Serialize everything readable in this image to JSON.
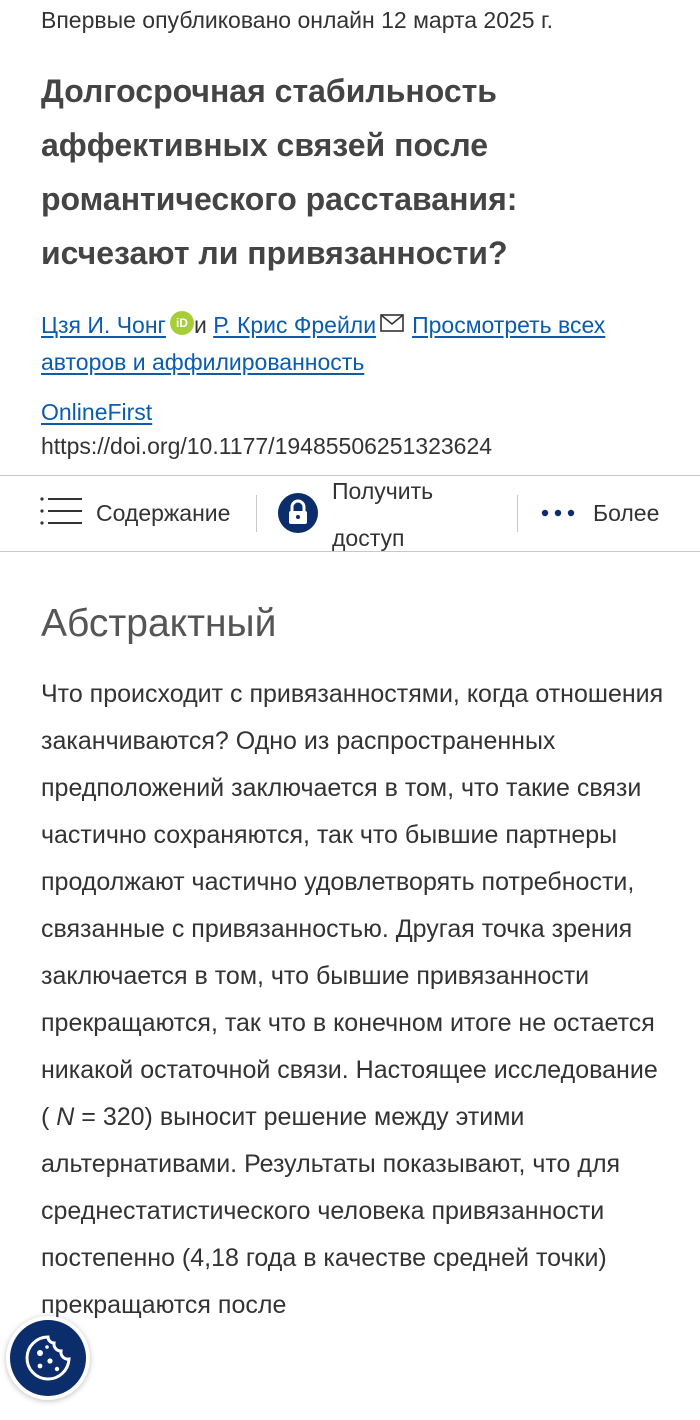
{
  "article": {
    "pub_date": "Впервые опубликовано онлайн 12 марта 2025 г.",
    "title": "Долгосрочная стабильность аффективных связей после романтического расставания: исчезают ли привязанности?",
    "authors": {
      "author1": "Цзя И. Чонг",
      "orcid_label": "iD",
      "conjunction": "и",
      "author2": "Р. Крис Фрейли",
      "view_all": "Просмотреть всех авторов и аффилированность"
    },
    "online_first": "OnlineFirst",
    "doi": "https://doi.org/10.1177/19485506251323624"
  },
  "toolbar": {
    "contents_label": "Содержание",
    "access_label": "Получить доступ",
    "more_label": "Более"
  },
  "abstract": {
    "heading": "Абстрактный",
    "text_part1": "Что происходит с привязанностями, когда отношения заканчиваются? Одно из распространенных предположений заключается в том, что такие связи частично сохраняются, так что бывшие партнеры продолжают частично удовлетворять потребности, связанные с привязанностью. Другая точка зрения заключается в том, что бывшие привязанности прекращаются, так что в конечном итоге не остается никакой остаточной связи. Настоящее исследование ( ",
    "n_symbol": "N",
    "text_part2": " = 320) выносит решение между этими альтернативами. Результаты показывают, что для среднестатистического человека привязанности постепенно (4,18 года в качестве средней точки) прекращаются после"
  },
  "colors": {
    "link": "#0b5cad",
    "brand_navy": "#0c2d6b",
    "orcid_green": "#a6ce39",
    "divider": "#c8c8c8"
  },
  "icons": {
    "orcid": "orcid-icon",
    "mail": "mail-icon",
    "contents": "list-menu-icon",
    "access": "lock-icon",
    "more": "more-dots-icon",
    "cookie": "cookie-icon"
  }
}
